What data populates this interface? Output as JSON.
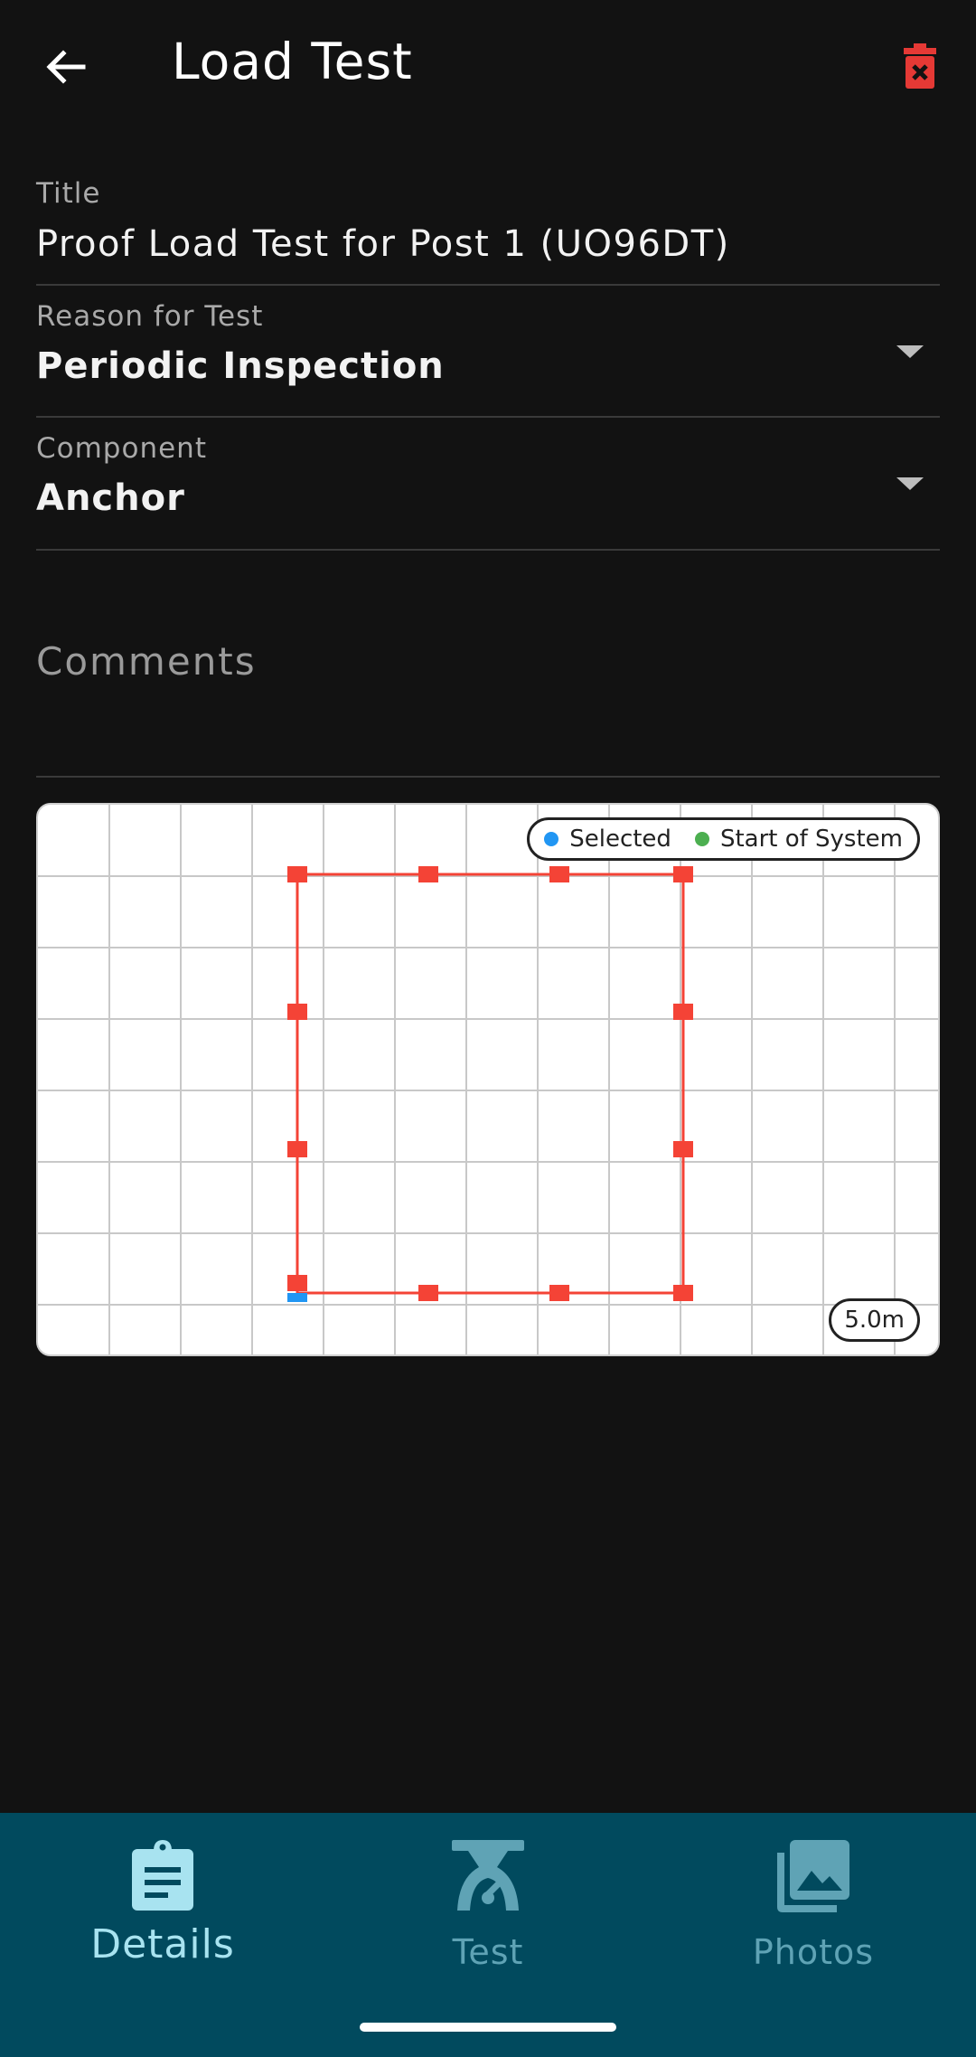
{
  "app_bar": {
    "title": "Load Test",
    "back_icon": "arrow-left-icon",
    "delete_icon": "trash-icon",
    "delete_color": "#e53935"
  },
  "form": {
    "title_field": {
      "label": "Title",
      "value": "Proof Load Test for Post 1 (UO96DT)"
    },
    "reason_field": {
      "label": "Reason for Test",
      "value": "Periodic Inspection"
    },
    "component_field": {
      "label": "Component",
      "value": "Anchor"
    },
    "comments_field": {
      "label": "Comments",
      "value": ""
    }
  },
  "diagram": {
    "legend": {
      "selected_label": "Selected",
      "selected_color": "#2196f3",
      "start_label": "Start of System",
      "start_color": "#4caf50"
    },
    "scale_label": "5.0m",
    "line_color": "#f44336",
    "node_color": "#f44336",
    "grid_color": "#c8c8c8"
  },
  "bottom_nav": {
    "items": [
      {
        "label": "Details",
        "icon": "clipboard-icon",
        "active": true
      },
      {
        "label": "Test",
        "icon": "scale-icon",
        "active": false
      },
      {
        "label": "Photos",
        "icon": "photo-library-icon",
        "active": false
      }
    ],
    "active_color": "#a8e3f0",
    "inactive_color": "#5fa3b5"
  }
}
